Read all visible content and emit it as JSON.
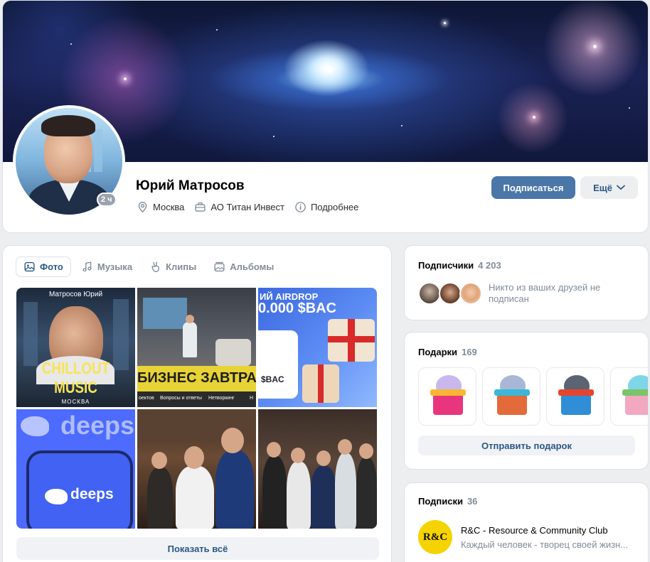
{
  "profile": {
    "name": "Юрий Матросов",
    "online_badge": "2 ч",
    "city": "Москва",
    "company": "АО Титан Инвест",
    "details_link": "Подробнее",
    "subscribe_button": "Подписаться",
    "more_button": "Ещё"
  },
  "media": {
    "tabs": [
      {
        "label": "Фото",
        "icon": "photo-icon",
        "active": true
      },
      {
        "label": "Музыка",
        "icon": "music-note-icon",
        "active": false
      },
      {
        "label": "Клипы",
        "icon": "clips-icon",
        "active": false
      },
      {
        "label": "Альбомы",
        "icon": "albums-icon",
        "active": false
      }
    ],
    "photos": {
      "chillout": {
        "top_text": "Матросов Юрий",
        "title": "CHILLOUT MUSIC",
        "subtitle": "МОСКВА"
      },
      "business": {
        "title": "БИЗНЕС ЗАВТРА",
        "footer_items": [
          "оектов",
          "Вопросы и ответы",
          "Нетворкинг",
          "Н"
        ]
      },
      "airdrop": {
        "line1": "ИЙ AIRDROP",
        "line2": "0.000 $BAC",
        "panel": "$BAC"
      },
      "deepseek": {
        "bg_text": "deeps",
        "phone_text": "deeps"
      }
    },
    "show_all": "Показать всё"
  },
  "followers": {
    "title": "Подписчики",
    "count": "4 203",
    "note": "Никто из ваших друзей не подписан"
  },
  "gifts": {
    "title": "Подарки",
    "count": "169",
    "send_button": "Отправить подарок"
  },
  "subscriptions": {
    "title": "Подписки",
    "count": "36",
    "items": [
      {
        "logo": "R&C",
        "title": "R&C - Resource & Community Club",
        "description": "Каждый человек - творец своей жизн..."
      }
    ]
  },
  "colors": {
    "accent": "#4a76a8",
    "link": "#2a5885",
    "secondary_text": "#818c99",
    "page_bg": "#edeef0"
  }
}
